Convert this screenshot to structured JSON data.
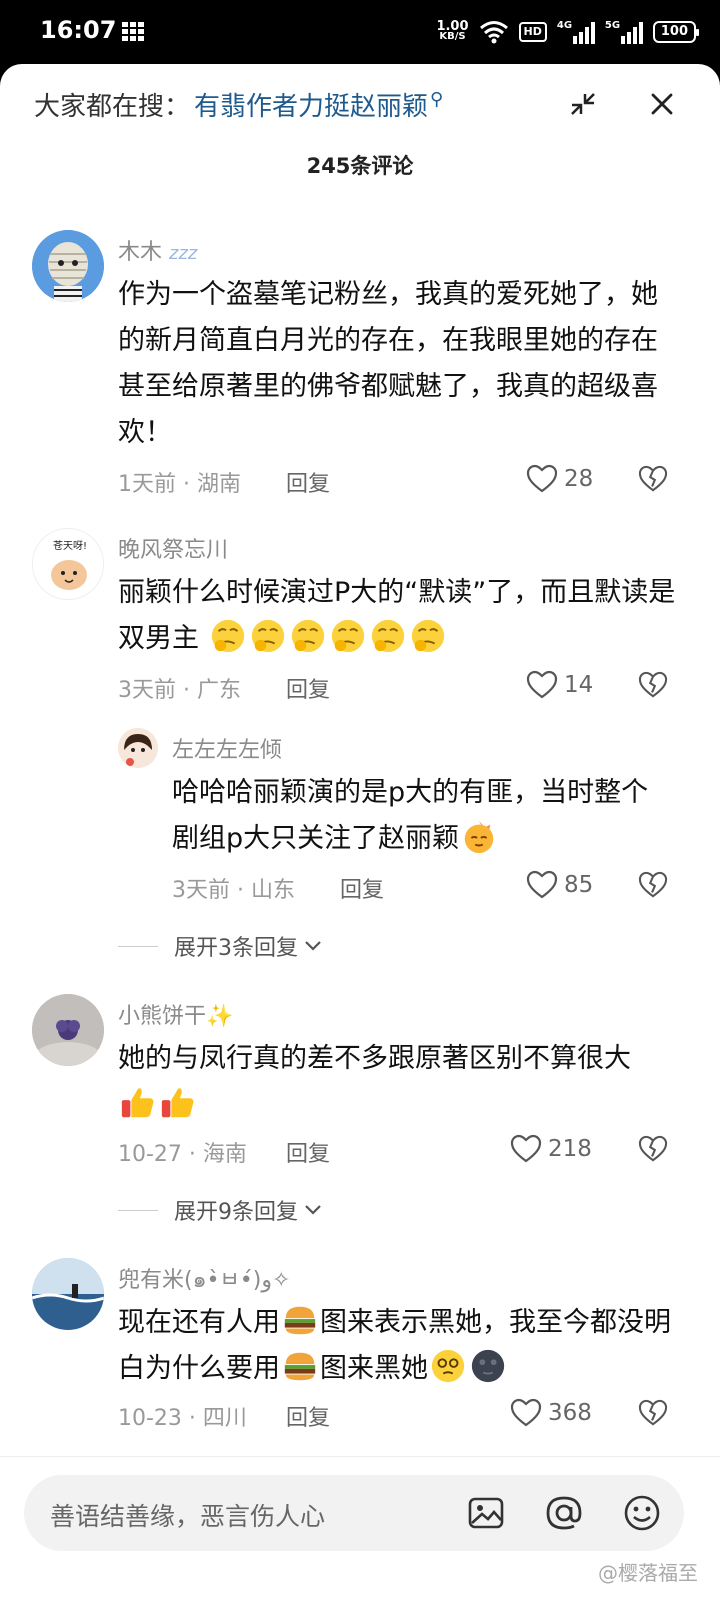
{
  "status": {
    "time": "16:07",
    "speed_value": "1.00",
    "speed_unit": "KB/S",
    "hd_label": "HD",
    "sig1_label": "4G",
    "sig2_label": "5G",
    "battery": "100"
  },
  "header": {
    "search_prefix": "大家都在搜：",
    "search_term": "有翡作者力挺赵丽颖",
    "comment_count": "245条评论"
  },
  "comments": [
    {
      "username": "木木",
      "text": "作为一个盗墓笔记粉丝，我真的爱死她了，她的新月简直白月光的存在，在我眼里她的存在甚至给原著里的佛爷都赋魅了，我真的超级喜欢！",
      "meta": "1天前 · 湖南",
      "reply": "回复",
      "likes": "28"
    },
    {
      "username": "晚风祭忘川",
      "text": "丽颖什么时候演过P大的“默读”了，而且默读是双男主",
      "meta": "3天前 · 广东",
      "reply": "回复",
      "likes": "14",
      "avatar_text": "苍天呀!"
    },
    {
      "username": "左左左左倾",
      "text": "哈哈哈丽颖演的是p大的有匪，当时整个剧组p大只关注了赵丽颖",
      "meta": "3天前 · 山东",
      "reply": "回复",
      "likes": "85",
      "expand": "展开3条回复"
    },
    {
      "username": "小熊饼干✨",
      "text": "她的与凤行真的差不多跟原著区别不算很大",
      "meta": "10-27 · 海南",
      "reply": "回复",
      "likes": "218",
      "expand": "展开9条回复"
    },
    {
      "username": "兜有米(๑•̀ㅂ•́)و✧",
      "text_a": "现在还有人用",
      "text_b": "图来表示黑她，我至今都没明白为什么要用",
      "text_c": "图来黑她",
      "meta": "10-23 · 四川",
      "reply": "回复",
      "likes": "368"
    }
  ],
  "bottom": {
    "placeholder": "善语结善缘，恶言伤人心",
    "watermark": "@樱落福至"
  }
}
